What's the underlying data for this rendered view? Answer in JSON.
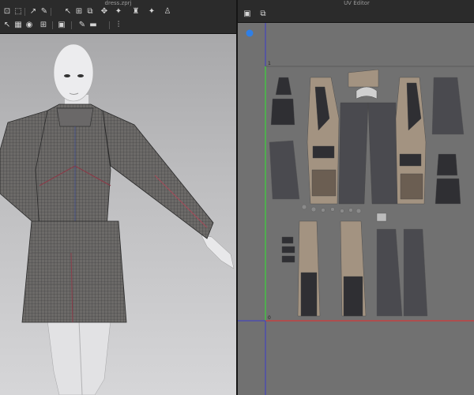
{
  "left_window": {
    "title": "dress.zprj"
  },
  "right_window": {
    "title": "UV Editor"
  },
  "uv_axis": {
    "origin_label": "0",
    "top_label": "1"
  },
  "colors": {
    "panel_bg": "#2b2b2b",
    "viewport_bg": "#bdbdbf",
    "uv_bg": "#717171",
    "uv_axis_y": "#3bd43b",
    "uv_axis_x": "#d43b3b",
    "uv_axis_blue": "#3b3bd4",
    "piece_dark": "#2f2f33",
    "piece_gray": "#4a4a4f",
    "piece_tan": "#a39381",
    "piece_brown": "#6b5e52"
  },
  "toolbar_left_row1": [
    "select-icon",
    "transform-icon",
    "move-icon",
    "sewing-icon",
    "avatar-icon",
    "fold-icon",
    "arrange-icon",
    "pin-icon",
    "skeleton-icon",
    "figure-icon"
  ],
  "toolbar_left_row2": [
    "cursor-icon",
    "texture-icon",
    "sphere-icon",
    "grid-icon",
    "camera-icon",
    "edit-icon",
    "split-icon"
  ],
  "toolbar_right": [
    "uv-snapshot-icon",
    "uv-camera-icon"
  ]
}
